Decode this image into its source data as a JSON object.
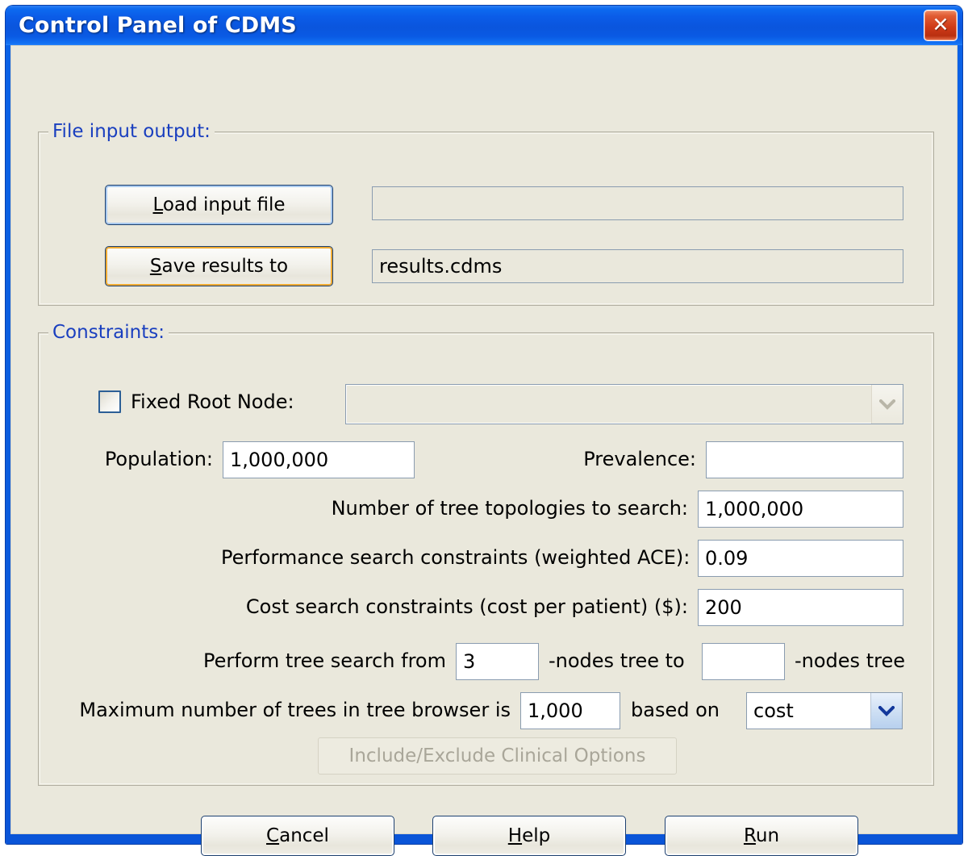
{
  "window": {
    "title": "Control Panel of CDMS",
    "close_label": "✕"
  },
  "file_io": {
    "legend": "File input output:",
    "load_button": {
      "pre": "",
      "mnemonic": "L",
      "post": "oad input file"
    },
    "save_button": {
      "pre": "",
      "mnemonic": "S",
      "post": "ave results to"
    },
    "input_file_value": "",
    "output_file_value": "results.cdms"
  },
  "constraints": {
    "legend": "Constraints:",
    "fixed_root_node": {
      "label": "Fixed Root Node:",
      "checked": false,
      "dropdown_value": "",
      "dropdown_enabled": false
    },
    "population": {
      "label": "Population:",
      "value": "1,000,000"
    },
    "prevalence": {
      "label": "Prevalence:",
      "value": ""
    },
    "topologies": {
      "label": "Number of tree topologies to search:",
      "value": "1,000,000"
    },
    "performance": {
      "label": "Performance search constraints (weighted ACE):",
      "value": "0.09"
    },
    "cost": {
      "label": "Cost search constraints (cost per patient) ($):",
      "value": "200"
    },
    "tree_search": {
      "label_from": "Perform tree search from",
      "value_from": "3",
      "label_mid": "-nodes tree to",
      "value_to": "",
      "label_end": "-nodes tree"
    },
    "max_trees": {
      "label": "Maximum number of trees in tree browser is",
      "value": "1,000",
      "based_on_label": "based on",
      "based_on_value": "cost",
      "based_on_options": [
        "cost"
      ]
    },
    "include_exclude_button": "Include/Exclude Clinical Options"
  },
  "actions": {
    "cancel": {
      "mnemonic": "C",
      "post": "ancel"
    },
    "help": {
      "pre": "H",
      "mnemonic": "H",
      "post": "elp"
    },
    "run": {
      "mnemonic": "R",
      "post": "un"
    }
  },
  "colors": {
    "titlebar_blue": "#0b5ce8",
    "dialog_bg": "#eae8dc",
    "legend_blue": "#1a3fbf",
    "close_red": "#cf3b18",
    "focus_orange": "#f0ab33",
    "default_ring_blue": "#a9c9ef"
  }
}
